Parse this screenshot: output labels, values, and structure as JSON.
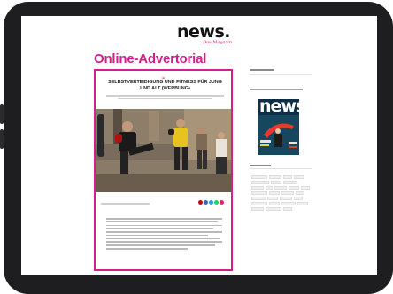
{
  "site": {
    "logo_main": "news.",
    "logo_sub": "Das Magazin"
  },
  "ad_label": "Online-Advertorial",
  "article": {
    "title": "SELBSTVERTEIDIGUNG UND FITNESS FÜR JUNG UND ALT (WERBUNG)"
  },
  "sidebar": {
    "cover_title": "news."
  },
  "colors": {
    "accent_magenta": "#d51e8a",
    "device_bezel": "#1e1e20",
    "cover_bg": "#0e2f45",
    "share_colors": [
      "#d0021b",
      "#4267b2",
      "#1da1f2",
      "#25d366",
      "#e0245e"
    ]
  }
}
